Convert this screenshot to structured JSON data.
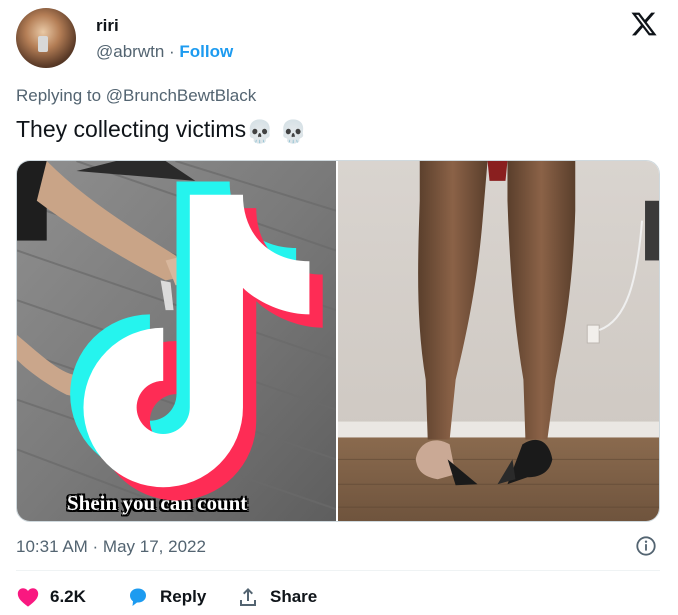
{
  "user": {
    "name": "riri",
    "handle": "@abrwtn",
    "separator": " · ",
    "follow_label": "Follow"
  },
  "reply_context": "Replying to @BrunchBewtBlack",
  "tweet": {
    "text": "They collecting victims",
    "emoji": "💀 💀"
  },
  "media": {
    "left_caption": "Shein you can count"
  },
  "timestamp": "10:31 AM · May 17, 2022",
  "actions": {
    "likes": "6.2K",
    "reply_label": "Reply",
    "share_label": "Share"
  },
  "colors": {
    "accent": "#1d9bf0",
    "like": "#f91880",
    "secondary_text": "#536471"
  },
  "icons": [
    "x-logo-icon",
    "heart-icon",
    "reply-bubble-icon",
    "share-icon",
    "info-icon",
    "tiktok-icon",
    "skull-emoji"
  ]
}
